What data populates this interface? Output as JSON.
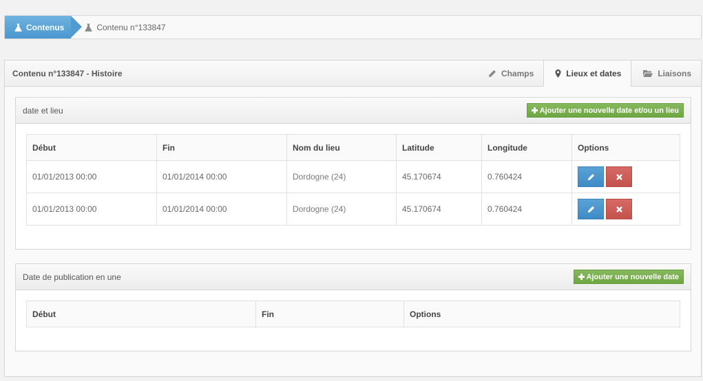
{
  "breadcrumb": {
    "active": "Contenus",
    "current": "Contenu n°133847"
  },
  "panel": {
    "title": "Contenu n°133847 - Histoire",
    "tabs": [
      {
        "label": "Champs",
        "icon": "pencil-icon"
      },
      {
        "label": "Lieux et dates",
        "icon": "map-marker-icon"
      },
      {
        "label": "Liaisons",
        "icon": "folder-icon"
      }
    ]
  },
  "dates_lieux": {
    "title": "date et lieu",
    "add_button": "Ajouter une nouvelle date et/ou un lieu",
    "columns": [
      "Début",
      "Fin",
      "Nom du lieu",
      "Latitude",
      "Longitude",
      "Options"
    ],
    "rows": [
      [
        "01/01/2013 00:00",
        "01/01/2014 00:00",
        "Dordogne (24)",
        "45.170674",
        "0.760424"
      ],
      [
        "01/01/2013 00:00",
        "01/01/2014 00:00",
        "Dordogne (24)",
        "45.170674",
        "0.760424"
      ]
    ]
  },
  "publication": {
    "title": "Date de publication en une",
    "add_button": "Ajouter une nouvelle date",
    "columns": [
      "Début",
      "Fin",
      "Options"
    ]
  },
  "colors": {
    "accent_blue": "#4a97cf",
    "green": "#6ea743",
    "red": "#c4524d"
  }
}
